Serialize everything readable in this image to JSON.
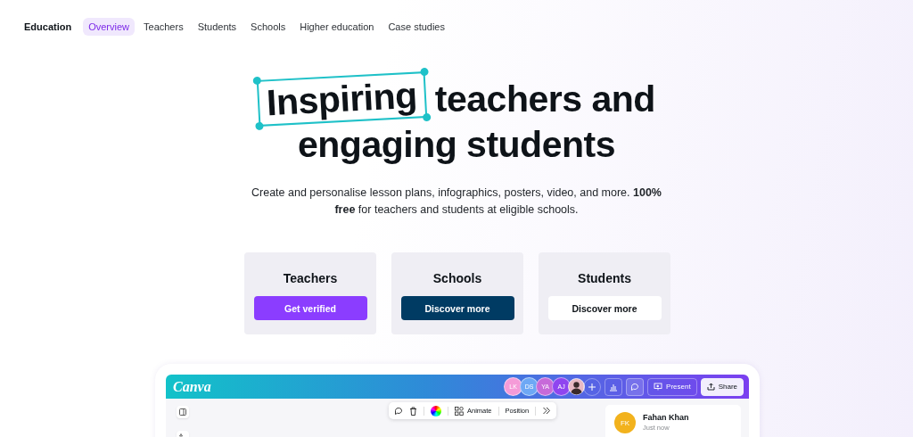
{
  "nav": {
    "brand": "Education",
    "items": [
      {
        "label": "Overview",
        "selected": true
      },
      {
        "label": "Teachers",
        "selected": false
      },
      {
        "label": "Students",
        "selected": false
      },
      {
        "label": "Schools",
        "selected": false
      },
      {
        "label": "Higher education",
        "selected": false
      },
      {
        "label": "Case studies",
        "selected": false
      }
    ]
  },
  "hero": {
    "highlight": "Inspiring",
    "line1_rest": "teachers and",
    "line2": "engaging students",
    "subtitle": "Create and personalise lesson plans, infographics, posters, video, and more. **100% free** for teachers and students at eligible schools."
  },
  "cards": [
    {
      "title": "Teachers",
      "button": "Get verified",
      "kind": "primary"
    },
    {
      "title": "Schools",
      "button": "Discover more",
      "kind": "dark"
    },
    {
      "title": "Students",
      "button": "Discover more",
      "kind": "light"
    }
  ],
  "editor": {
    "logo": "Canva",
    "collaborators": [
      {
        "initials": "LK",
        "color": "#f59bd8"
      },
      {
        "initials": "DS",
        "color": "#6ea8f5"
      },
      {
        "initials": "YA",
        "color": "#c76ad9"
      },
      {
        "initials": "AJ",
        "color": "#8f45f0"
      }
    ],
    "present": "Present",
    "share": "Share",
    "toolbar": {
      "animate": "Animate",
      "position": "Position"
    },
    "comment": {
      "initials": "FK",
      "name": "Fahan Khan",
      "time": "Just now"
    }
  }
}
